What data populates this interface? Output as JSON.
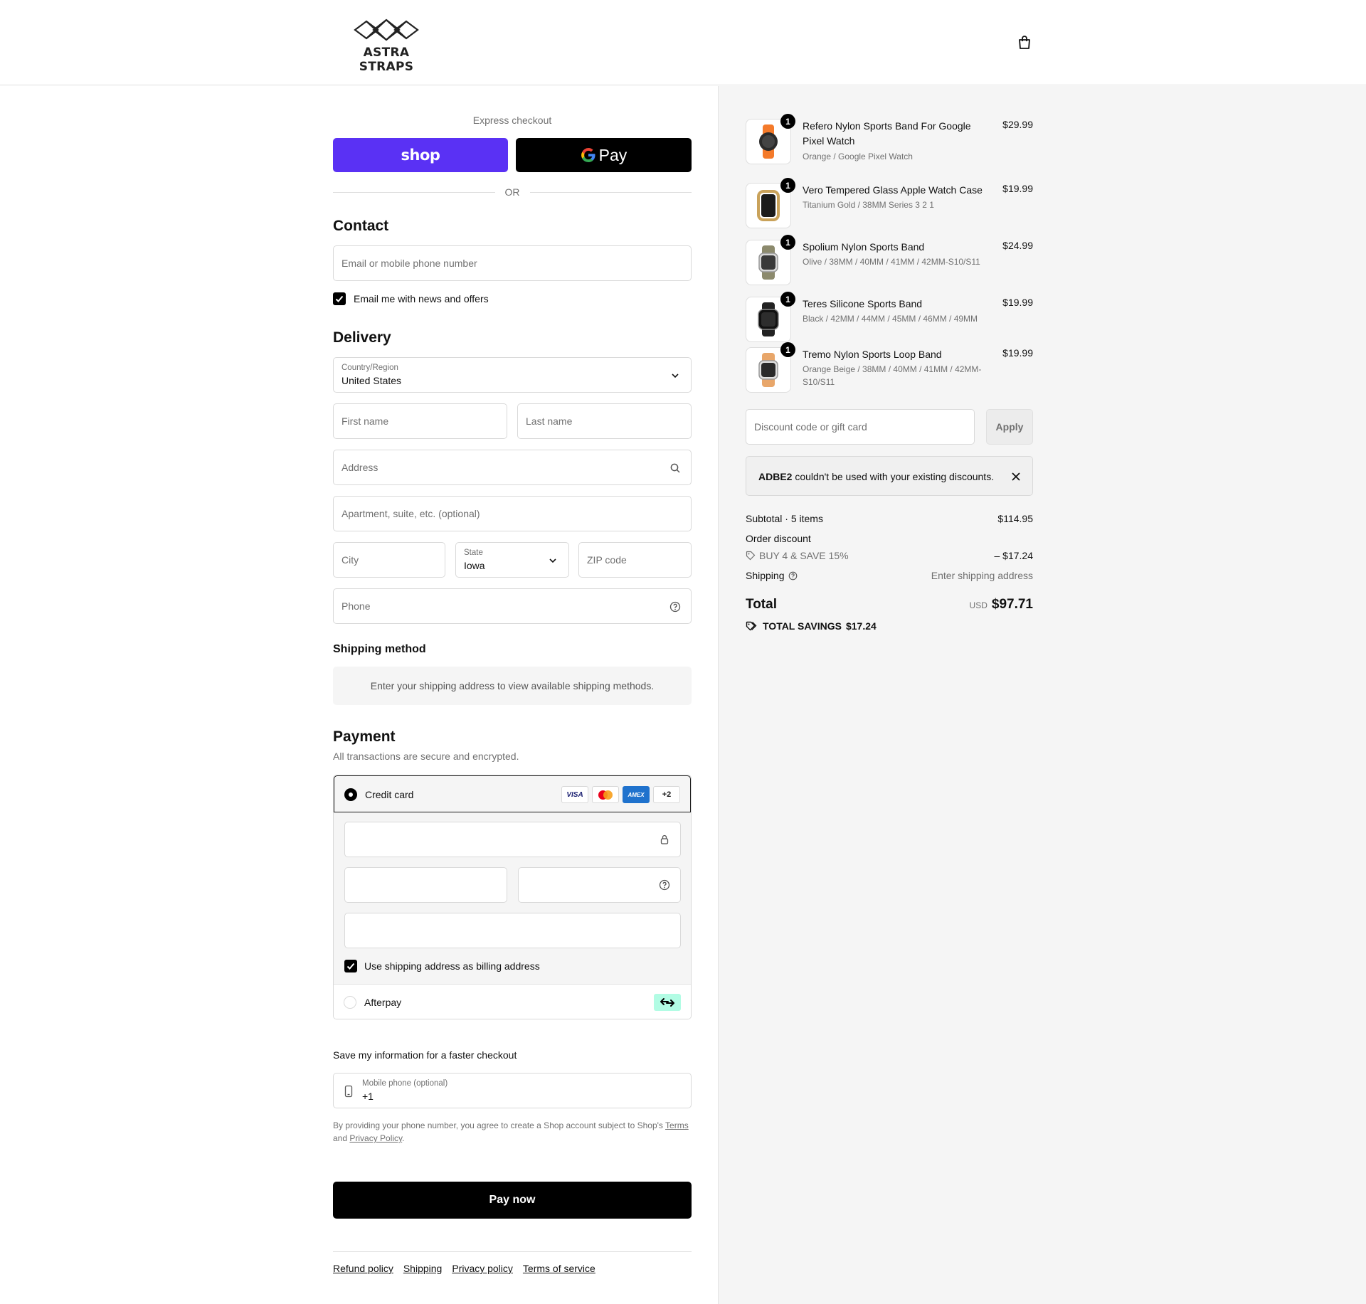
{
  "brand": {
    "name": "ASTRA STRAPS"
  },
  "express": {
    "label": "Express checkout",
    "shop_label": "shop",
    "gpay_label": "Pay",
    "or_label": "OR"
  },
  "contact": {
    "title": "Contact",
    "email_placeholder": "Email or mobile phone number",
    "newsletter_label": "Email me with news and offers",
    "newsletter_checked": true
  },
  "delivery": {
    "title": "Delivery",
    "country_label": "Country/Region",
    "country_value": "United States",
    "first_name_placeholder": "First name",
    "last_name_placeholder": "Last name",
    "address_placeholder": "Address",
    "apartment_placeholder": "Apartment, suite, etc. (optional)",
    "city_placeholder": "City",
    "state_label": "State",
    "state_value": "Iowa",
    "zip_placeholder": "ZIP code",
    "phone_placeholder": "Phone"
  },
  "shipping_method": {
    "title": "Shipping method",
    "notice": "Enter your shipping address to view available shipping methods."
  },
  "payment": {
    "title": "Payment",
    "subtitle": "All transactions are secure and encrypted.",
    "credit_card_label": "Credit card",
    "card_brands": [
      "VISA",
      "Mastercard",
      "AMEX",
      "+2"
    ],
    "billing_label": "Use shipping address as billing address",
    "billing_checked": true,
    "afterpay_label": "Afterpay"
  },
  "save_info": {
    "title": "Save my information for a faster checkout",
    "mobile_label": "Mobile phone (optional)",
    "mobile_value": "+1",
    "legal_prefix": "By providing your phone number, you agree to create a Shop account subject to Shop's",
    "terms_link": "Terms",
    "legal_and": "and",
    "privacy_link": "Privacy Policy",
    "legal_suffix": "."
  },
  "pay_button": "Pay now",
  "footer_links": [
    "Refund policy",
    "Shipping",
    "Privacy policy",
    "Terms of service"
  ],
  "cart": {
    "items": [
      {
        "name": "Refero Nylon Sports Band For Google Pixel Watch",
        "variant": "Orange / Google Pixel Watch",
        "price": "$29.99",
        "qty": "1",
        "color": "#f47a2a"
      },
      {
        "name": "Vero Tempered Glass Apple Watch Case",
        "variant": "Titanium Gold / 38MM Series 3 2 1",
        "price": "$19.99",
        "qty": "1",
        "color": "#c9a25a"
      },
      {
        "name": "Spolium Nylon Sports Band",
        "variant": "Olive / 38MM / 40MM / 41MM / 42MM-S10/S11",
        "price": "$24.99",
        "qty": "1",
        "color": "#8c8a6d"
      },
      {
        "name": "Teres Silicone Sports Band",
        "variant": "Black / 42MM / 44MM / 45MM / 46MM / 49MM",
        "price": "$19.99",
        "qty": "1",
        "color": "#222222"
      },
      {
        "name": "Tremo Nylon Sports Loop Band",
        "variant": "Orange Beige / 38MM / 40MM / 41MM / 42MM-S10/S11",
        "price": "$19.99",
        "qty": "1",
        "color": "#e8a66a"
      }
    ],
    "discount_placeholder": "Discount code or gift card",
    "apply_label": "Apply",
    "notice_code": "ADBE2",
    "notice_text": "couldn't be used with your existing discounts.",
    "subtotal_label": "Subtotal · 5 items",
    "subtotal_value": "$114.95",
    "order_discount_label": "Order discount",
    "discount_name": "BUY 4 & SAVE 15%",
    "discount_value": "– $17.24",
    "shipping_label": "Shipping",
    "shipping_value": "Enter shipping address",
    "total_label": "Total",
    "total_currency": "USD",
    "total_value": "$97.71",
    "savings_label": "TOTAL SAVINGS",
    "savings_value": "$17.24"
  }
}
